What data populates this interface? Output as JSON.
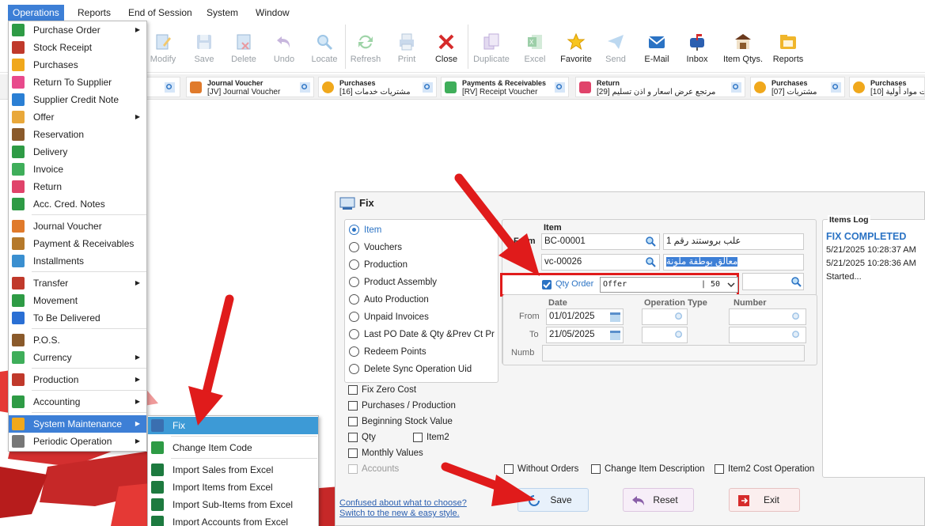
{
  "menubar": {
    "items": [
      "Operations",
      "Reports",
      "End of Session",
      "System",
      "Window"
    ]
  },
  "toolbar": {
    "buttons": [
      {
        "label": "Modify",
        "icon": "modify-icon"
      },
      {
        "label": "Save",
        "icon": "save-icon"
      },
      {
        "label": "Delete",
        "icon": "delete-icon"
      },
      {
        "label": "Undo",
        "icon": "undo-icon"
      },
      {
        "label": "Locate",
        "icon": "locate-icon"
      },
      {
        "label": "Refresh",
        "icon": "refresh-icon"
      },
      {
        "label": "Print",
        "icon": "print-icon"
      },
      {
        "label": "Close",
        "icon": "close-icon"
      },
      {
        "label": "Duplicate",
        "icon": "duplicate-icon"
      },
      {
        "label": "Excel",
        "icon": "excel-icon"
      },
      {
        "label": "Favorite",
        "icon": "star-icon"
      },
      {
        "label": "Send",
        "icon": "send-icon"
      },
      {
        "label": "E-Mail",
        "icon": "email-icon"
      },
      {
        "label": "Inbox",
        "icon": "inbox-icon"
      },
      {
        "label": "Item Qtys.",
        "icon": "warehouse-icon"
      },
      {
        "label": "Reports",
        "icon": "reports-icon"
      }
    ]
  },
  "recent": {
    "items": [
      {
        "title": "Journal Voucher",
        "sub": "[JV] Journal Voucher"
      },
      {
        "title": "Purchases",
        "sub": "[16] مشتريات خدمات"
      },
      {
        "title": "Payments & Receivables",
        "sub": "[RV] Receipt Voucher"
      },
      {
        "title": "Return",
        "sub": "[29] مرتجع عرض اسعار و اذن تسليم"
      },
      {
        "title": "Purchases",
        "sub": "[07] مشتريات"
      },
      {
        "title": "Purchases",
        "sub": "[10] مشتريات مواد أولية"
      }
    ],
    "left_fragments": [
      "vo",
      "ier",
      "عر"
    ]
  },
  "operations_menu": {
    "items": [
      {
        "label": "Purchase Order",
        "submenu": true,
        "icon": "purchase-order-icon",
        "color": "#2e9b45"
      },
      {
        "label": "Stock Receipt",
        "submenu": false,
        "icon": "stock-receipt-icon",
        "color": "#c0392b"
      },
      {
        "label": "Purchases",
        "submenu": false,
        "icon": "purchases-icon",
        "color": "#f0a81c"
      },
      {
        "label": "Return To Supplier",
        "submenu": false,
        "icon": "return-supplier-icon",
        "color": "#e84a8c"
      },
      {
        "label": "Supplier Credit Note",
        "submenu": false,
        "icon": "credit-note-icon",
        "color": "#2a7fd4"
      },
      {
        "label": "Offer",
        "submenu": true,
        "icon": "offer-icon",
        "color": "#e9a83a"
      },
      {
        "label": "Reservation",
        "submenu": false,
        "icon": "reservation-icon",
        "color": "#8a5a2b"
      },
      {
        "label": "Delivery",
        "submenu": false,
        "icon": "delivery-icon",
        "color": "#2e9b45"
      },
      {
        "label": "Invoice",
        "submenu": false,
        "icon": "invoice-icon",
        "color": "#3fae5a"
      },
      {
        "label": "Return",
        "submenu": false,
        "icon": "return-icon",
        "color": "#e0436a"
      },
      {
        "label": "Acc. Cred. Notes",
        "submenu": false,
        "icon": "acc-cred-icon",
        "color": "#2e9b45"
      },
      {
        "label": "Journal Voucher",
        "submenu": false,
        "icon": "journal-icon",
        "color": "#e07a2b"
      },
      {
        "label": "Payment & Receivables",
        "submenu": false,
        "icon": "payment-icon",
        "color": "#b5792b"
      },
      {
        "label": "Installments",
        "submenu": false,
        "icon": "installments-icon",
        "color": "#3a8fd0"
      },
      {
        "label": "Transfer",
        "submenu": true,
        "icon": "transfer-icon",
        "color": "#c0392b"
      },
      {
        "label": "Movement",
        "submenu": false,
        "icon": "movement-icon",
        "color": "#2e9b45"
      },
      {
        "label": "To Be Delivered",
        "submenu": false,
        "icon": "to-be-delivered-icon",
        "color": "#2a6fd4"
      },
      {
        "label": "P.O.S.",
        "submenu": false,
        "icon": "pos-icon",
        "color": "#8a5a2b"
      },
      {
        "label": "Currency",
        "submenu": true,
        "icon": "currency-icon",
        "color": "#3fae5a"
      },
      {
        "label": "Production",
        "submenu": true,
        "icon": "production-icon",
        "color": "#c0392b"
      },
      {
        "label": "Accounting",
        "submenu": true,
        "icon": "accounting-icon",
        "color": "#2e9b45"
      },
      {
        "label": "System Maintenance",
        "submenu": true,
        "icon": "maintenance-icon",
        "color": "#f0a81c"
      },
      {
        "label": "Periodic Operation",
        "submenu": true,
        "icon": "periodic-icon",
        "color": "#777777"
      }
    ]
  },
  "submenu": {
    "items": [
      {
        "label": "Fix",
        "icon": "fix-icon",
        "color": "#3a6fb0"
      },
      {
        "label": "Change Item Code",
        "icon": "change-code-icon",
        "color": "#2e9b45"
      },
      {
        "label": "Import Sales from Excel",
        "icon": "excel-icon",
        "color": "#1d7a3f"
      },
      {
        "label": "Import Items from Excel",
        "icon": "excel-icon",
        "color": "#1d7a3f"
      },
      {
        "label": "Import Sub-Items from Excel",
        "icon": "excel-icon",
        "color": "#1d7a3f"
      },
      {
        "label": "Import Accounts from Excel",
        "icon": "excel-icon",
        "color": "#1d7a3f"
      }
    ]
  },
  "fix_window": {
    "title": "Fix",
    "options": [
      "Item",
      "Vouchers",
      "Production",
      "Product Assembly",
      "Auto Production",
      "Unpaid Invoices",
      "Last PO Date & Qty &Prev Ct Pr",
      "Redeem Points",
      "Delete Sync Operation Uid"
    ],
    "selected_option": "Item",
    "item_header": "Item",
    "from_label": "From",
    "from_code": "BC-00001",
    "from_name": "علب بروستند رقم 1",
    "to_code": "vc-00026",
    "to_name": "معالق بوطفة ملونة",
    "qty_order_label": "Qty Order",
    "qty_order_checked": true,
    "qty_order_value": "Offer",
    "qty_order_num": "| 50",
    "date_header": "Date",
    "op_type_header": "Operation Type",
    "number_header": "Number",
    "date_from_label": "From",
    "date_from": "01/01/2025",
    "date_to_label": "To",
    "date_to": "21/05/2025",
    "numb_label": "Numb",
    "checks_left": [
      {
        "label": "Fix Zero Cost",
        "checked": false,
        "disabled": false
      },
      {
        "label": "Purchases / Production",
        "checked": false,
        "disabled": false
      },
      {
        "label": "Beginning Stock Value",
        "checked": false,
        "disabled": false
      },
      {
        "label": "Qty",
        "checked": false,
        "disabled": false
      },
      {
        "label": "Monthly Values",
        "checked": false,
        "disabled": false
      },
      {
        "label": "Accounts",
        "checked": false,
        "disabled": true
      }
    ],
    "item2_label": "Item2",
    "checks_bottom": [
      "Without Orders",
      "Change Item Description",
      "Item2 Cost Operation"
    ],
    "items_log_title": "Items Log",
    "log_lines": [
      "FIX COMPLETED",
      "5/21/2025 10:28:37 AM",
      "5/21/2025 10:28:36 AM",
      "Started..."
    ],
    "help_link_1": "Confused about what to choose?",
    "help_link_2": "Switch to the new & easy style.",
    "save_label": "Save",
    "reset_label": "Reset",
    "exit_label": "Exit"
  }
}
